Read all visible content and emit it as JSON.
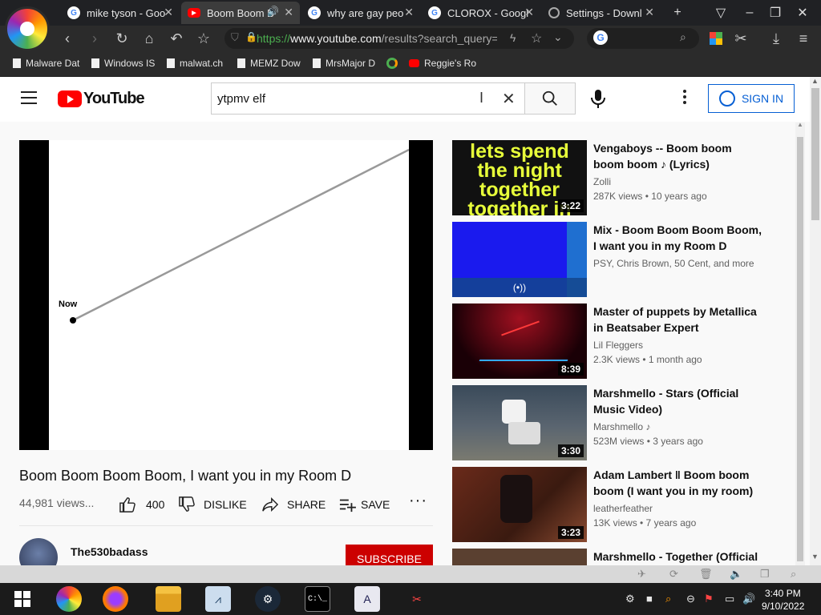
{
  "browser": {
    "tabs": [
      {
        "label": "mike tyson - Goo",
        "icon": "google-icon"
      },
      {
        "label": "Boom Boom B",
        "icon": "youtube-icon"
      },
      {
        "label": "why are gay peo",
        "icon": "google-icon"
      },
      {
        "label": "CLOROX - Googl",
        "icon": "google-icon"
      },
      {
        "label": "Settings - Downl",
        "icon": "gear-icon"
      }
    ],
    "url": {
      "scheme": "https://",
      "host": "www.youtube.com",
      "path": "/results?search_query="
    },
    "bookmarks": [
      "Malware Dat",
      "Windows IS",
      "malwat.ch",
      "MEMZ Dow",
      "MrsMajor D",
      "",
      "Reggie's Ro"
    ]
  },
  "youtube": {
    "logo_text": "YouTube",
    "search_value": "ytpmv elf",
    "sign_in_label": "SIGN IN",
    "player": {
      "label": "Now"
    },
    "video": {
      "title": "Boom Boom Boom Boom, I want you in my Room D",
      "views": "44,981 views...",
      "likes": "400",
      "dislike_label": "DISLIKE",
      "share_label": "SHARE",
      "save_label": "SAVE"
    },
    "channel": {
      "name": "The530badass",
      "subscribe_label": "SUBSCRIBE"
    },
    "recommendations": [
      {
        "title": "Vengaboys -- Boom boom boom boom ♪ (Lyrics)",
        "channel": "Zolli",
        "meta": "287K views • 10 years ago",
        "duration": "3:22",
        "thumb_text": "lets spend the night together together in my room"
      },
      {
        "title": "Mix - Boom Boom Boom Boom, I want you in my Room D",
        "channel": "PSY, Chris Brown, 50 Cent, and more",
        "meta": "",
        "duration": ""
      },
      {
        "title": "Master of puppets by Metallica in Beatsaber Expert",
        "channel": "Lil Fleggers",
        "meta": "2.3K views • 1 month ago",
        "duration": "8:39"
      },
      {
        "title": "Marshmello - Stars (Official Music Video)",
        "channel": "Marshmello",
        "meta": "523M views • 3 years ago",
        "duration": "3:30"
      },
      {
        "title": "Adam Lambert ‖ Boom boom boom (I want you in my room)",
        "channel": "leatherfeather",
        "meta": "13K views • 7 years ago",
        "duration": "3:23"
      },
      {
        "title": "Marshmello - Together (Official",
        "channel": "",
        "meta": "",
        "duration": ""
      }
    ]
  },
  "taskbar": {
    "time": "3:40 PM",
    "date": "9/10/2022"
  }
}
